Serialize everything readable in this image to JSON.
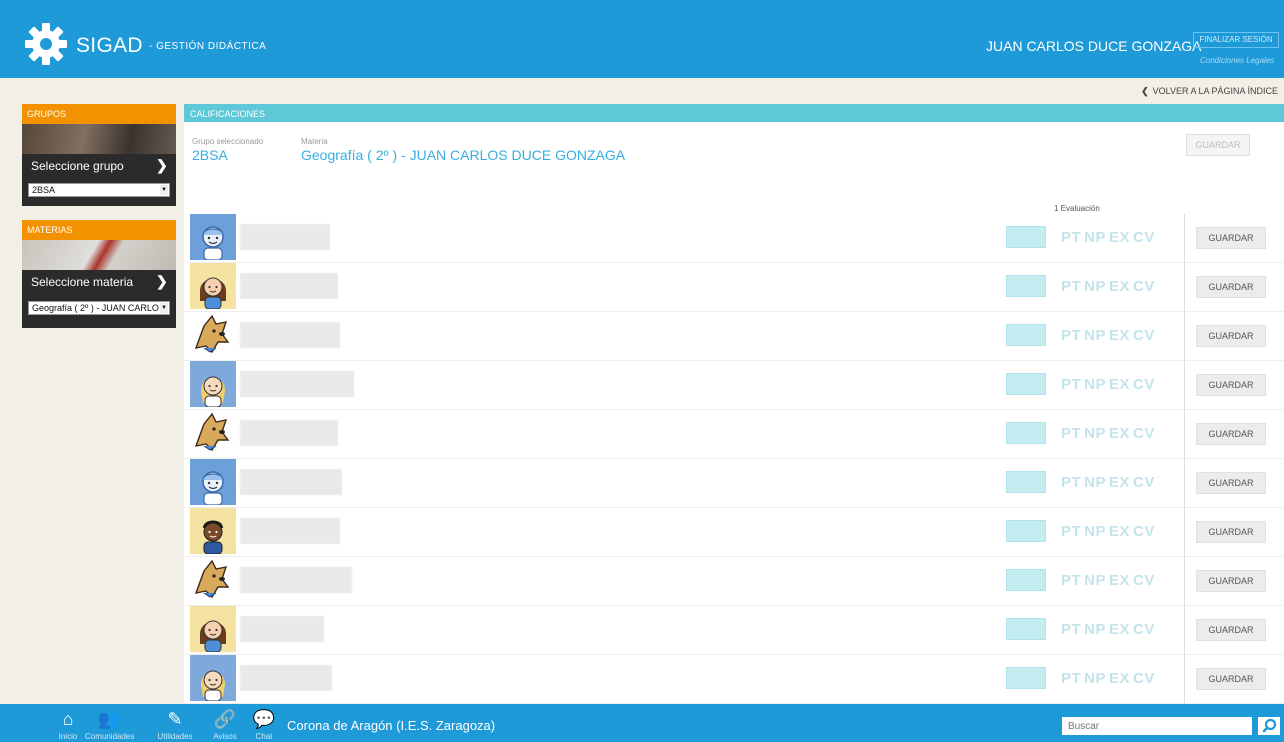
{
  "header": {
    "app_name": "SIGAD",
    "app_subtitle": "- GESTIÓN DIDÁCTICA",
    "user_name": "JUAN CARLOS DUCE GONZAGA",
    "logout_label": "FINALIZAR SESIÓN",
    "legal_label": "Condiciones Legales",
    "back_label": "VOLVER A LA PÁGINA ÍNDICE"
  },
  "sidebar": {
    "groups_title": "GRUPOS",
    "groups_prompt": "Seleccione grupo",
    "groups_selected": "2BSA",
    "subjects_title": "MATERIAS",
    "subjects_prompt": "Seleccione materia",
    "subjects_selected": "Geografía ( 2º ) - JUAN CARLO"
  },
  "main": {
    "section_title": "CALIFICACIONES",
    "group_label": "Grupo seleccionado",
    "group_value": "2BSA",
    "subject_label": "Materia",
    "subject_value": "Geografía ( 2º ) - JUAN CARLOS DUCE GONZAGA",
    "save_label": "GUARDAR",
    "evaluation_label": "1 Evaluación",
    "codes": [
      "PT",
      "NP",
      "EX",
      "CV"
    ],
    "students": [
      {
        "avatar": "boy-blue-icon",
        "avatar_bg": "#6d9fd8"
      },
      {
        "avatar": "girl-brown-hair-icon",
        "avatar_bg": "#f4e2a0"
      },
      {
        "avatar": "dog-mascot-icon",
        "avatar_bg": "#ffffff"
      },
      {
        "avatar": "blonde-girl-icon",
        "avatar_bg": "#7fa8db"
      },
      {
        "avatar": "dog-mascot-icon",
        "avatar_bg": "#ffffff"
      },
      {
        "avatar": "boy-blue-icon",
        "avatar_bg": "#6d9fd8"
      },
      {
        "avatar": "dark-boy-icon",
        "avatar_bg": "#f4e2a0"
      },
      {
        "avatar": "dog-mascot-icon",
        "avatar_bg": "#ffffff"
      },
      {
        "avatar": "girl-brown-hair-icon",
        "avatar_bg": "#f4e2a0"
      },
      {
        "avatar": "blonde-girl-icon",
        "avatar_bg": "#7fa8db"
      }
    ]
  },
  "footer": {
    "nav": [
      {
        "label": "Inicio",
        "icon": "home-icon"
      },
      {
        "label": "Comunidades",
        "icon": "people-icon"
      },
      {
        "label": "Utilidades",
        "icon": "pencil-icon"
      },
      {
        "label": "Avisos",
        "icon": "paperclip-icon"
      },
      {
        "label": "Chat",
        "icon": "chat-icon"
      }
    ],
    "center_name": "Corona de Aragón (I.E.S. Zaragoza)",
    "search_placeholder": "Buscar"
  },
  "colors": {
    "brand_blue": "#1f9ad9",
    "sidebar_orange": "#f39200",
    "teal_header": "#5ec8d8",
    "grade_cyan": "#c4edf1"
  }
}
